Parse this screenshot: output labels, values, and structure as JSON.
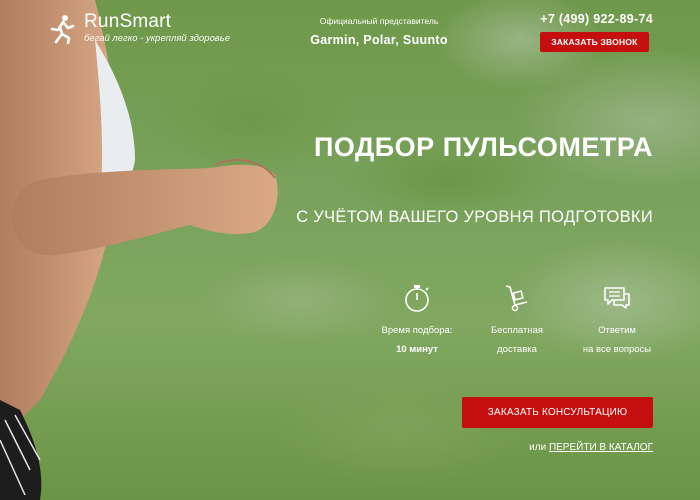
{
  "header": {
    "brand": "RunSmart",
    "tagline": "бегай легко - укрепляй здоровье",
    "dealer_label": "Официальный представитель",
    "dealer_brands": "Garmin, Polar, Suunto",
    "phone": "+7 (499) 922-89-74",
    "callback_label": "ЗАКАЗАТЬ ЗВОНОК"
  },
  "hero": {
    "title": "ПОДБОР ПУЛЬСОМЕТРА",
    "subtitle": "С УЧЁТОМ ВАШЕГО УРОВНЯ ПОДГОТОВКИ"
  },
  "features": [
    {
      "icon": "stopwatch-icon",
      "line1": "Время подбора:",
      "line2": "10 минут"
    },
    {
      "icon": "hand-truck-icon",
      "line1": "Бесплатная",
      "line2": "доставка"
    },
    {
      "icon": "chat-icon",
      "line1": "Ответим",
      "line2": "на все вопросы"
    }
  ],
  "cta": {
    "label": "ЗАКАЗАТЬ КОНСУЛЬТАЦИЮ",
    "or_text": "или",
    "catalog_link": "ПЕРЕЙТИ В КАТАЛОГ"
  },
  "colors": {
    "accent": "#c50f0f",
    "text": "#ffffff"
  }
}
